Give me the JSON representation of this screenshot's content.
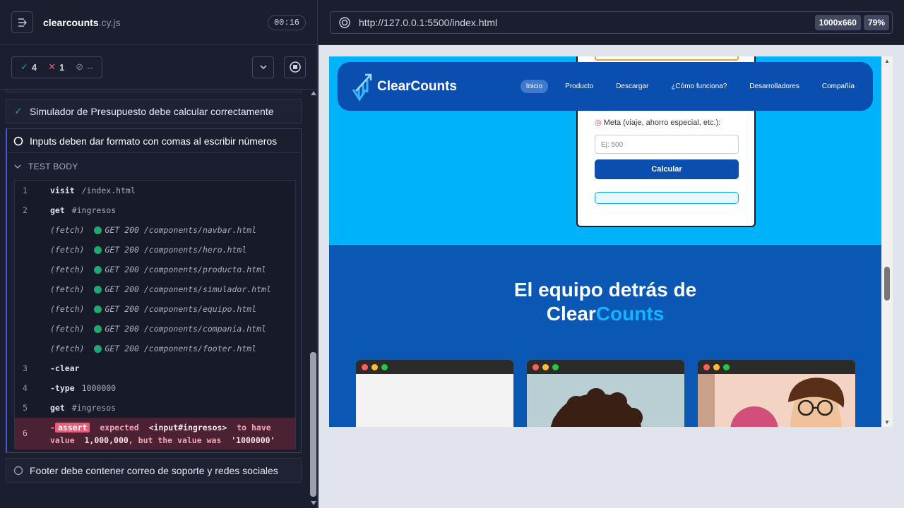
{
  "runner": {
    "spec_name": "clearcounts",
    "spec_ext": ".cy.js",
    "timer": "00:16",
    "stats": {
      "passed": "4",
      "failed": "1",
      "pending": "--"
    }
  },
  "tests": [
    {
      "title": "Simulador de Presupuesto debe calcular correctamente",
      "state": "passed"
    },
    {
      "title": "Inputs deben dar formato con comas al escribir números",
      "state": "running"
    },
    {
      "title": "Footer debe contener correo de soporte y redes sociales",
      "state": "pending"
    }
  ],
  "test_body_label": "TEST BODY",
  "commands": [
    {
      "num": "1",
      "name": "visit",
      "msg": "/index.html"
    },
    {
      "num": "2",
      "name": "get",
      "msg": "#ingresos"
    },
    {
      "fetch": "(fetch)",
      "req": "GET 200 /components/navbar.html"
    },
    {
      "fetch": "(fetch)",
      "req": "GET 200 /components/hero.html"
    },
    {
      "fetch": "(fetch)",
      "req": "GET 200 /components/producto.html"
    },
    {
      "fetch": "(fetch)",
      "req": "GET 200 /components/simulador.html"
    },
    {
      "fetch": "(fetch)",
      "req": "GET 200 /components/equipo.html"
    },
    {
      "fetch": "(fetch)",
      "req": "GET 200 /components/compania.html"
    },
    {
      "fetch": "(fetch)",
      "req": "GET 200 /components/footer.html"
    },
    {
      "num": "3",
      "name": "-clear",
      "msg": ""
    },
    {
      "num": "4",
      "name": "-type",
      "msg": "1000000"
    },
    {
      "num": "5",
      "name": "get",
      "msg": "#ingresos"
    }
  ],
  "error_command": {
    "num": "6",
    "dash": "-",
    "tag": "assert",
    "p1": "expected",
    "el": "<input#ingresos>",
    "p2": "to have",
    "p3": "value",
    "v1": "1,000,000",
    "p4": ", but the value was",
    "v2": "'1000000'"
  },
  "browser": {
    "url": "http://127.0.0.1:5500/index.html",
    "size": "1000x660",
    "zoom": "79%"
  },
  "site": {
    "logo": "ClearCounts",
    "nav": [
      "Inicio",
      "Producto",
      "Descargar",
      "¿Cómo funciona?",
      "Desarrolladores",
      "Compañía"
    ],
    "meta_label": "Meta (viaje, ahorro especial, etc.):",
    "meta_placeholder": "Ej: 500",
    "calc_button": "Calcular",
    "team_title_1": "El equipo detrás de",
    "team_title_2a": "Clear",
    "team_title_2b": "Counts"
  },
  "colors": {
    "accent": "#4956e3",
    "pass": "#1fa971",
    "fail": "#e85d7a",
    "site_bg": "#00b2fa",
    "site_nav": "#0a4fb0"
  }
}
